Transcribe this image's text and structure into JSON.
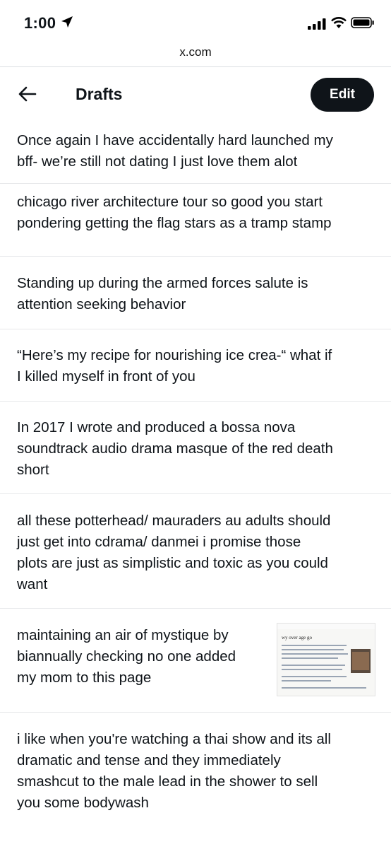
{
  "status_bar": {
    "time": "1:00",
    "icons": [
      "location-arrow-icon",
      "cellular-signal-icon",
      "wifi-icon",
      "battery-icon"
    ]
  },
  "browser": {
    "url": "x.com"
  },
  "header": {
    "title": "Drafts",
    "edit_label": "Edit",
    "back_icon": "arrow-left-icon"
  },
  "drafts": [
    {
      "lines": [
        "Once again I have accidentally hard launched my",
        "bff- we’re still not dating I just love them alot"
      ]
    },
    {
      "lines": [
        "chicago river architecture tour so good you start",
        "pondering getting the flag stars as a tramp stamp"
      ]
    },
    {
      "lines": [
        "Standing up during the armed forces salute is",
        "attention seeking behavior"
      ]
    },
    {
      "lines": [
        "“Here’s my recipe for nourishing ice crea-“ what if",
        "I killed myself in front of you"
      ]
    },
    {
      "lines": [
        "In 2017 I wrote and produced a bossa nova",
        "soundtrack audio drama masque of the red death",
        "short"
      ]
    },
    {
      "lines": [
        "all these potterhead/ mauraders au adults should",
        "just get into cdrama/ danmei i promise those",
        "plots are just as simplistic and toxic as you could",
        "want"
      ]
    },
    {
      "lines": [
        "maintaining an air of mystique by",
        "biannually checking no one added",
        "my mom to this page"
      ],
      "thumbnail_text": "wy over age go"
    },
    {
      "lines": [
        "i like when you're watching a thai show and its all",
        "dramatic and tense and they immediately",
        "smashcut to the male lead in the shower to sell",
        "you some bodywash"
      ]
    }
  ],
  "colors": {
    "text": "#0f1419",
    "button_bg": "#0f1419",
    "button_text": "#ffffff",
    "divider": "#e6e8ea"
  }
}
